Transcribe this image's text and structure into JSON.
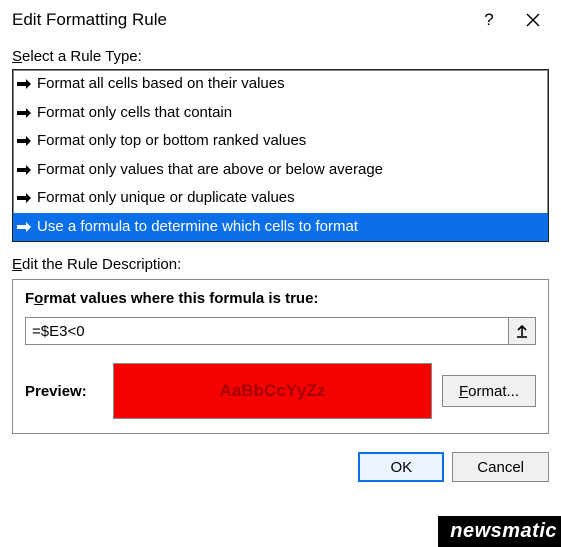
{
  "dialog": {
    "title": "Edit Formatting Rule"
  },
  "ruleType": {
    "label_pre": "",
    "label_u": "S",
    "label_post": "elect a Rule Type:",
    "items": [
      "Format all cells based on their values",
      "Format only cells that contain",
      "Format only top or bottom ranked values",
      "Format only values that are above or below average",
      "Format only unique or duplicate values",
      "Use a formula to determine which cells to format"
    ],
    "selected_index": 5
  },
  "ruleDescription": {
    "label_pre": "",
    "label_u": "E",
    "label_post": "dit the Rule Description:",
    "formula_label_pre": "F",
    "formula_label_u": "o",
    "formula_label_post": "rmat values where this formula is true:",
    "formula_value": "=$E3<0",
    "preview_label": "Preview:",
    "preview_text": "AaBbCcYyZz",
    "preview_bg": "#f40200",
    "preview_color": "#a40000",
    "format_btn_u": "F",
    "format_btn_post": "ormat..."
  },
  "buttons": {
    "ok": "OK",
    "cancel": "Cancel"
  },
  "watermark": "newsmatic"
}
